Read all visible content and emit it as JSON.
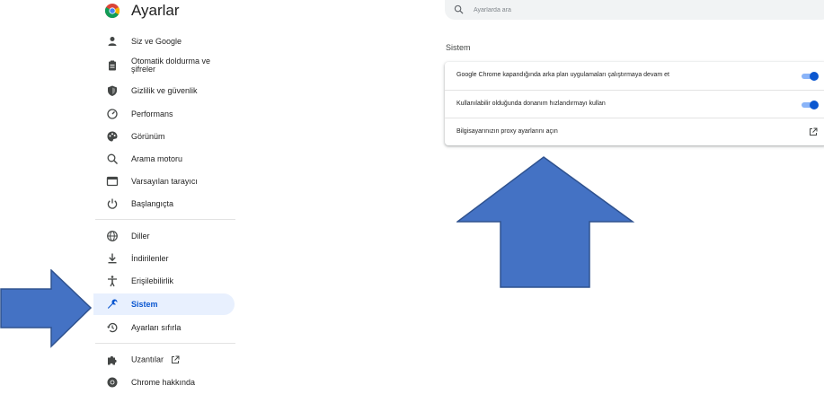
{
  "app": {
    "title": "Ayarlar"
  },
  "search": {
    "placeholder": "Ayarlarda ara"
  },
  "sidebar": {
    "items": [
      {
        "label": "Siz ve Google",
        "icon": "person-icon"
      },
      {
        "label": "Otomatik doldurma ve şifreler",
        "icon": "clipboard-icon"
      },
      {
        "label": "Gizlilik ve güvenlik",
        "icon": "shield-icon"
      },
      {
        "label": "Performans",
        "icon": "speedometer-icon"
      },
      {
        "label": "Görünüm",
        "icon": "palette-icon"
      },
      {
        "label": "Arama motoru",
        "icon": "search-icon"
      },
      {
        "label": "Varsayılan tarayıcı",
        "icon": "browser-icon"
      },
      {
        "label": "Başlangıçta",
        "icon": "power-icon"
      },
      {
        "label": "Diller",
        "icon": "globe-icon"
      },
      {
        "label": "İndirilenler",
        "icon": "download-icon"
      },
      {
        "label": "Erişilebilirlik",
        "icon": "accessibility-icon"
      },
      {
        "label": "Sistem",
        "icon": "wrench-icon",
        "active": true
      },
      {
        "label": "Ayarları sıfırla",
        "icon": "history-icon"
      },
      {
        "label": "Uzantılar",
        "icon": "puzzle-icon"
      },
      {
        "label": "Chrome hakkında",
        "icon": "chrome-icon"
      }
    ]
  },
  "main": {
    "section_title": "Sistem",
    "rows": [
      {
        "label": "Google Chrome kapandığında arka plan uygulamaları çalıştırmaya devam et",
        "control": "toggle",
        "checked": true
      },
      {
        "label": "Kullanılabilir olduğunda donanım hızlandırmayı kullan",
        "control": "toggle",
        "checked": true
      },
      {
        "label": "Bilgisayarınızın proxy ayarlarını açın",
        "control": "open-in-new-icon"
      }
    ]
  },
  "colors": {
    "accent": "#0b57d0",
    "active_nav_bg": "#e8f0fe",
    "toggle_track": "#8ab4f8",
    "annotation_arrow_fill": "#4472c4",
    "annotation_arrow_stroke": "#2f528f"
  }
}
